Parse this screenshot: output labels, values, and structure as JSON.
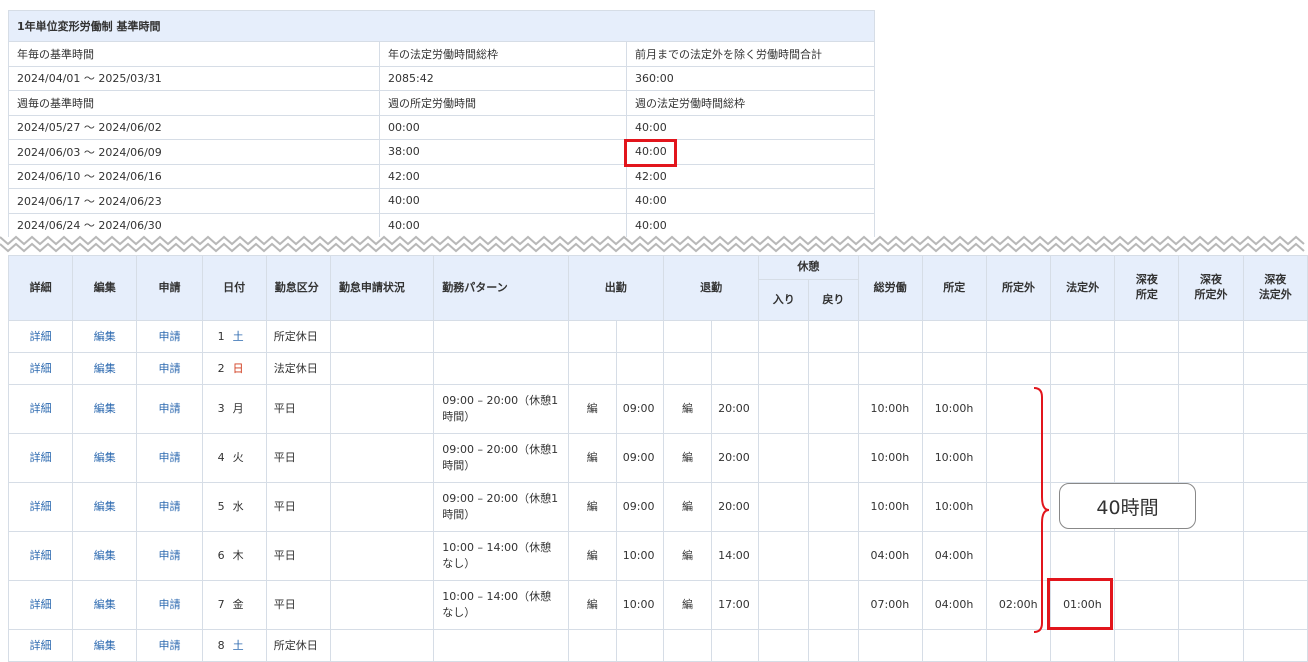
{
  "ref_table": {
    "title": "1年単位変形労働制 基準時間",
    "annual_header": [
      "年毎の基準時間",
      "年の法定労働時間総枠",
      "前月までの法定外を除く労働時間合計"
    ],
    "annual_row": [
      "2024/04/01 ～ 2025/03/31",
      "2085:42",
      "360:00"
    ],
    "weekly_header": [
      "週毎の基準時間",
      "週の所定労働時間",
      "週の法定労働時間総枠"
    ],
    "weekly_rows": [
      [
        "2024/05/27 ～ 2024/06/02",
        "00:00",
        "40:00"
      ],
      [
        "2024/06/03 ～ 2024/06/09",
        "38:00",
        "40:00"
      ],
      [
        "2024/06/10 ～ 2024/06/16",
        "42:00",
        "42:00"
      ],
      [
        "2024/06/17 ～ 2024/06/23",
        "40:00",
        "40:00"
      ],
      [
        "2024/06/24 ～ 2024/06/30",
        "40:00",
        "40:00"
      ]
    ]
  },
  "main_table": {
    "headers": {
      "detail": "詳細",
      "edit": "編集",
      "apply": "申請",
      "date": "日付",
      "category": "勤怠区分",
      "status": "勤怠申請状況",
      "pattern": "勤務パターン",
      "clock_in": "出勤",
      "clock_out": "退勤",
      "break": "休憩",
      "break_in": "入り",
      "break_out": "戻り",
      "total": "総労働",
      "scheduled": "所定",
      "non_scheduled": "所定外",
      "non_statutory": "法定外",
      "night_scheduled_1": "深夜",
      "night_scheduled_2": "所定",
      "night_non_scheduled_1": "深夜",
      "night_non_scheduled_2": "所定外",
      "night_non_statutory_1": "深夜",
      "night_non_statutory_2": "法定外"
    },
    "rows": [
      {
        "detail": "詳細",
        "edit": "編集",
        "apply": "申請",
        "day": "1",
        "weekday": "土",
        "cat": "所定休日",
        "pattern": "",
        "in_mark": "",
        "in": "",
        "out_mark": "",
        "out": "",
        "total": "",
        "sched": "",
        "nonsched": "",
        "nonstat": ""
      },
      {
        "detail": "詳細",
        "edit": "編集",
        "apply": "申請",
        "day": "2",
        "weekday": "日",
        "cat": "法定休日",
        "pattern": "",
        "in_mark": "",
        "in": "",
        "out_mark": "",
        "out": "",
        "total": "",
        "sched": "",
        "nonsched": "",
        "nonstat": ""
      },
      {
        "detail": "詳細",
        "edit": "編集",
        "apply": "申請",
        "day": "3",
        "weekday": "月",
        "cat": "平日",
        "pattern": "09:00 – 20:00（休憩1時間）",
        "in_mark": "編",
        "in": "09:00",
        "out_mark": "編",
        "out": "20:00",
        "total": "10:00h",
        "sched": "10:00h",
        "nonsched": "",
        "nonstat": ""
      },
      {
        "detail": "詳細",
        "edit": "編集",
        "apply": "申請",
        "day": "4",
        "weekday": "火",
        "cat": "平日",
        "pattern": "09:00 – 20:00（休憩1時間）",
        "in_mark": "編",
        "in": "09:00",
        "out_mark": "編",
        "out": "20:00",
        "total": "10:00h",
        "sched": "10:00h",
        "nonsched": "",
        "nonstat": ""
      },
      {
        "detail": "詳細",
        "edit": "編集",
        "apply": "申請",
        "day": "5",
        "weekday": "水",
        "cat": "平日",
        "pattern": "09:00 – 20:00（休憩1時間）",
        "in_mark": "編",
        "in": "09:00",
        "out_mark": "編",
        "out": "20:00",
        "total": "10:00h",
        "sched": "10:00h",
        "nonsched": "",
        "nonstat": ""
      },
      {
        "detail": "詳細",
        "edit": "編集",
        "apply": "申請",
        "day": "6",
        "weekday": "木",
        "cat": "平日",
        "pattern": "10:00 – 14:00（休憩なし）",
        "in_mark": "編",
        "in": "10:00",
        "out_mark": "編",
        "out": "14:00",
        "total": "04:00h",
        "sched": "04:00h",
        "nonsched": "",
        "nonstat": ""
      },
      {
        "detail": "詳細",
        "edit": "編集",
        "apply": "申請",
        "day": "7",
        "weekday": "金",
        "cat": "平日",
        "pattern": "10:00 – 14:00（休憩なし）",
        "in_mark": "編",
        "in": "10:00",
        "out_mark": "編",
        "out": "17:00",
        "total": "07:00h",
        "sched": "04:00h",
        "nonsched": "02:00h",
        "nonstat": "01:00h"
      },
      {
        "detail": "詳細",
        "edit": "編集",
        "apply": "申請",
        "day": "8",
        "weekday": "土",
        "cat": "所定休日",
        "pattern": "",
        "in_mark": "",
        "in": "",
        "out_mark": "",
        "out": "",
        "total": "",
        "sched": "",
        "nonsched": "",
        "nonstat": ""
      }
    ]
  },
  "annotation": {
    "bubble_text": "40時間",
    "highlight_color": "#e2151c"
  }
}
